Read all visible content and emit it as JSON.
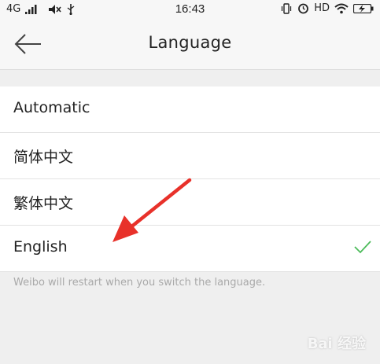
{
  "status_bar": {
    "network": "4G",
    "time": "16:43",
    "hd": "HD"
  },
  "header": {
    "title": "Language",
    "back_icon": "arrow-left-icon"
  },
  "languages": [
    {
      "label": "Automatic",
      "selected": false
    },
    {
      "label": "简体中文",
      "selected": false
    },
    {
      "label": "繁体中文",
      "selected": false
    },
    {
      "label": "English",
      "selected": true
    }
  ],
  "note": "Weibo will restart when you switch the language.",
  "colors": {
    "check": "#4cbb5a",
    "arrow": "#e8312a"
  },
  "watermark": "Bai 经验"
}
